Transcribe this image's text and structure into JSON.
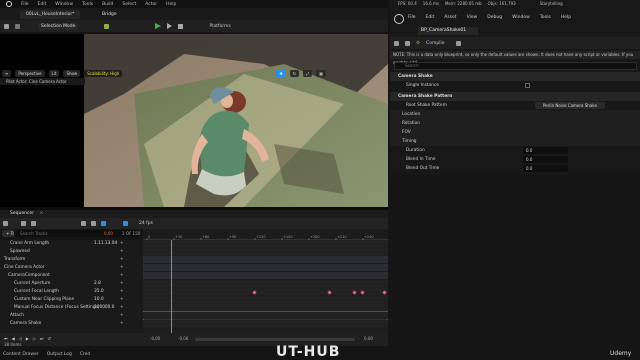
{
  "editor": {
    "menu": [
      "File",
      "Edit",
      "Window",
      "Tools",
      "Build",
      "Select",
      "Actor",
      "Help"
    ],
    "level_tab": "00LvL_HouseInterior*",
    "bridge_tab": "Bridge",
    "selection_mode": "Selection Mode",
    "platforms": "Platforms",
    "stats": {
      "fps_label": "FPS: 60.4",
      "ms": "16.6 ms",
      "mem": "Mem: 2280.05 mb",
      "objs": "Objs: 161,793",
      "storytelling": "Storytelling"
    },
    "viewport": {
      "perspective": "Perspective",
      "lit": "Lit",
      "show": "Show",
      "scalability": "Scalability: High",
      "pilot": "Pilot Actor: Cine Camera Actor"
    }
  },
  "sequencer": {
    "tab": "Sequencer",
    "track_btn": "Track",
    "fps": "24 fps",
    "frame": "0,00",
    "of": "1 OF 150",
    "search_placeholder": "Search Tracks",
    "tracks": [
      {
        "label": "Crane Arm Length",
        "value": "1.11.13.04"
      },
      {
        "label": "Spawned",
        "value": ""
      },
      {
        "label": "Transform",
        "value": ""
      },
      {
        "label": "Cine Camera Actor",
        "value": ""
      },
      {
        "label": "CameraComponent",
        "value": ""
      },
      {
        "label": "Current Aperture",
        "value": "2.8"
      },
      {
        "label": "Current Focal Length",
        "value": "35.0"
      },
      {
        "label": "Custom Near Clipping Plane",
        "value": "10.0"
      },
      {
        "label": "Manual Focus Distance (Focus Settings)",
        "value": "100000.0"
      },
      {
        "label": "Attach",
        "value": ""
      },
      {
        "label": "Camera Shake",
        "value": ""
      }
    ],
    "items_count": "38 items",
    "clip_labels": [
      "CameraRig_Crane",
      "BP_CameraShake01_C"
    ],
    "ruler": [
      "0",
      "+30",
      "+60",
      "+90",
      "+120",
      "+150",
      "+180",
      "+210",
      "+240",
      "+270"
    ],
    "bottom_left": "-0,00",
    "bottom_mid": "-0,00",
    "bottom_right": "0,00"
  },
  "blueprint": {
    "menu": [
      "File",
      "Edit",
      "Asset",
      "View",
      "Debug",
      "Window",
      "Tools",
      "Help"
    ],
    "tab": "BP_CameraShake01",
    "compile": "Compile",
    "note": "NOTE: This is a data only blueprint, so only the default values are shown. It does not have any script or variables. If you want to add",
    "search": "Search",
    "rows": [
      {
        "label": "Camera Shake",
        "kind": "cat",
        "value": ""
      },
      {
        "label": "Single Instance",
        "kind": "row",
        "value": ""
      },
      {
        "label": "Camera Shake Pattern",
        "kind": "cat",
        "value": ""
      },
      {
        "label": "Root Shake Pattern",
        "kind": "row",
        "value": "Perlin Noise Camera Shake Pattern"
      },
      {
        "label": "Location",
        "kind": "sub",
        "value": ""
      },
      {
        "label": "Rotation",
        "kind": "sub",
        "value": ""
      },
      {
        "label": "FOV",
        "kind": "sub",
        "value": ""
      },
      {
        "label": "Timing",
        "kind": "sub",
        "value": ""
      },
      {
        "label": "Duration",
        "kind": "row",
        "value": "0.0"
      },
      {
        "label": "Blend In Time",
        "kind": "row",
        "value": "0.0"
      },
      {
        "label": "Blend Out Time",
        "kind": "row",
        "value": "0.0"
      }
    ]
  },
  "status": {
    "items": [
      "Content Drawer",
      "Output Log",
      "Cmd"
    ],
    "watermark": "UT-HUB",
    "udemy": "Udemy"
  },
  "colors": {
    "accent": "#2b8fe6",
    "playhead": "#e8703a",
    "key": "#e06090"
  }
}
